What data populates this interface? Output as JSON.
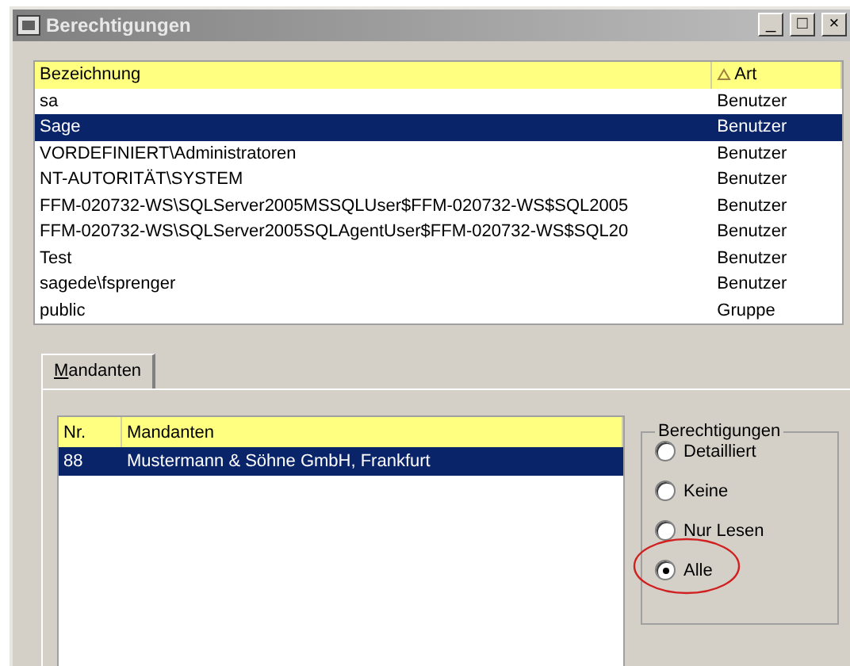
{
  "window": {
    "title": "Berechtigungen",
    "buttons": [
      "_",
      "□",
      "×"
    ]
  },
  "users": {
    "columns": [
      {
        "label": "Bezeichnung",
        "sorted": false
      },
      {
        "label": "Art",
        "sorted": true
      }
    ],
    "rows": [
      {
        "name": "sa",
        "type": "Benutzer",
        "selected": false
      },
      {
        "name": "Sage",
        "type": "Benutzer",
        "selected": true
      },
      {
        "name": "VORDEFINIERT\\Administratoren",
        "type": "Benutzer",
        "selected": false
      },
      {
        "name": "NT-AUTORITÄT\\SYSTEM",
        "type": "Benutzer",
        "selected": false
      },
      {
        "name": "FFM-020732-WS\\SQLServer2005MSSQLUser$FFM-020732-WS$SQL2005",
        "type": "Benutzer",
        "selected": false
      },
      {
        "name": "FFM-020732-WS\\SQLServer2005SQLAgentUser$FFM-020732-WS$SQL20",
        "type": "Benutzer",
        "selected": false
      },
      {
        "name": "Test",
        "type": "Benutzer",
        "selected": false
      },
      {
        "name": "sagede\\fsprenger",
        "type": "Benutzer",
        "selected": false
      },
      {
        "name": "public",
        "type": "Gruppe",
        "selected": false
      }
    ]
  },
  "tabs": [
    {
      "label": "Mandanten",
      "selected": true
    }
  ],
  "clients": {
    "columns": [
      "Nr.",
      "Mandanten"
    ],
    "rows": [
      {
        "nr": "88",
        "name": "Mustermann & Söhne GmbH, Frankfurt",
        "selected": true
      }
    ]
  },
  "permissions": {
    "title": "Berechtigungen",
    "options": [
      {
        "label": "Detailliert",
        "selected": false
      },
      {
        "label": "Keine",
        "selected": false
      },
      {
        "label": "Nur Lesen",
        "selected": false
      },
      {
        "label": "Alle",
        "selected": true,
        "circled": true
      }
    ]
  }
}
